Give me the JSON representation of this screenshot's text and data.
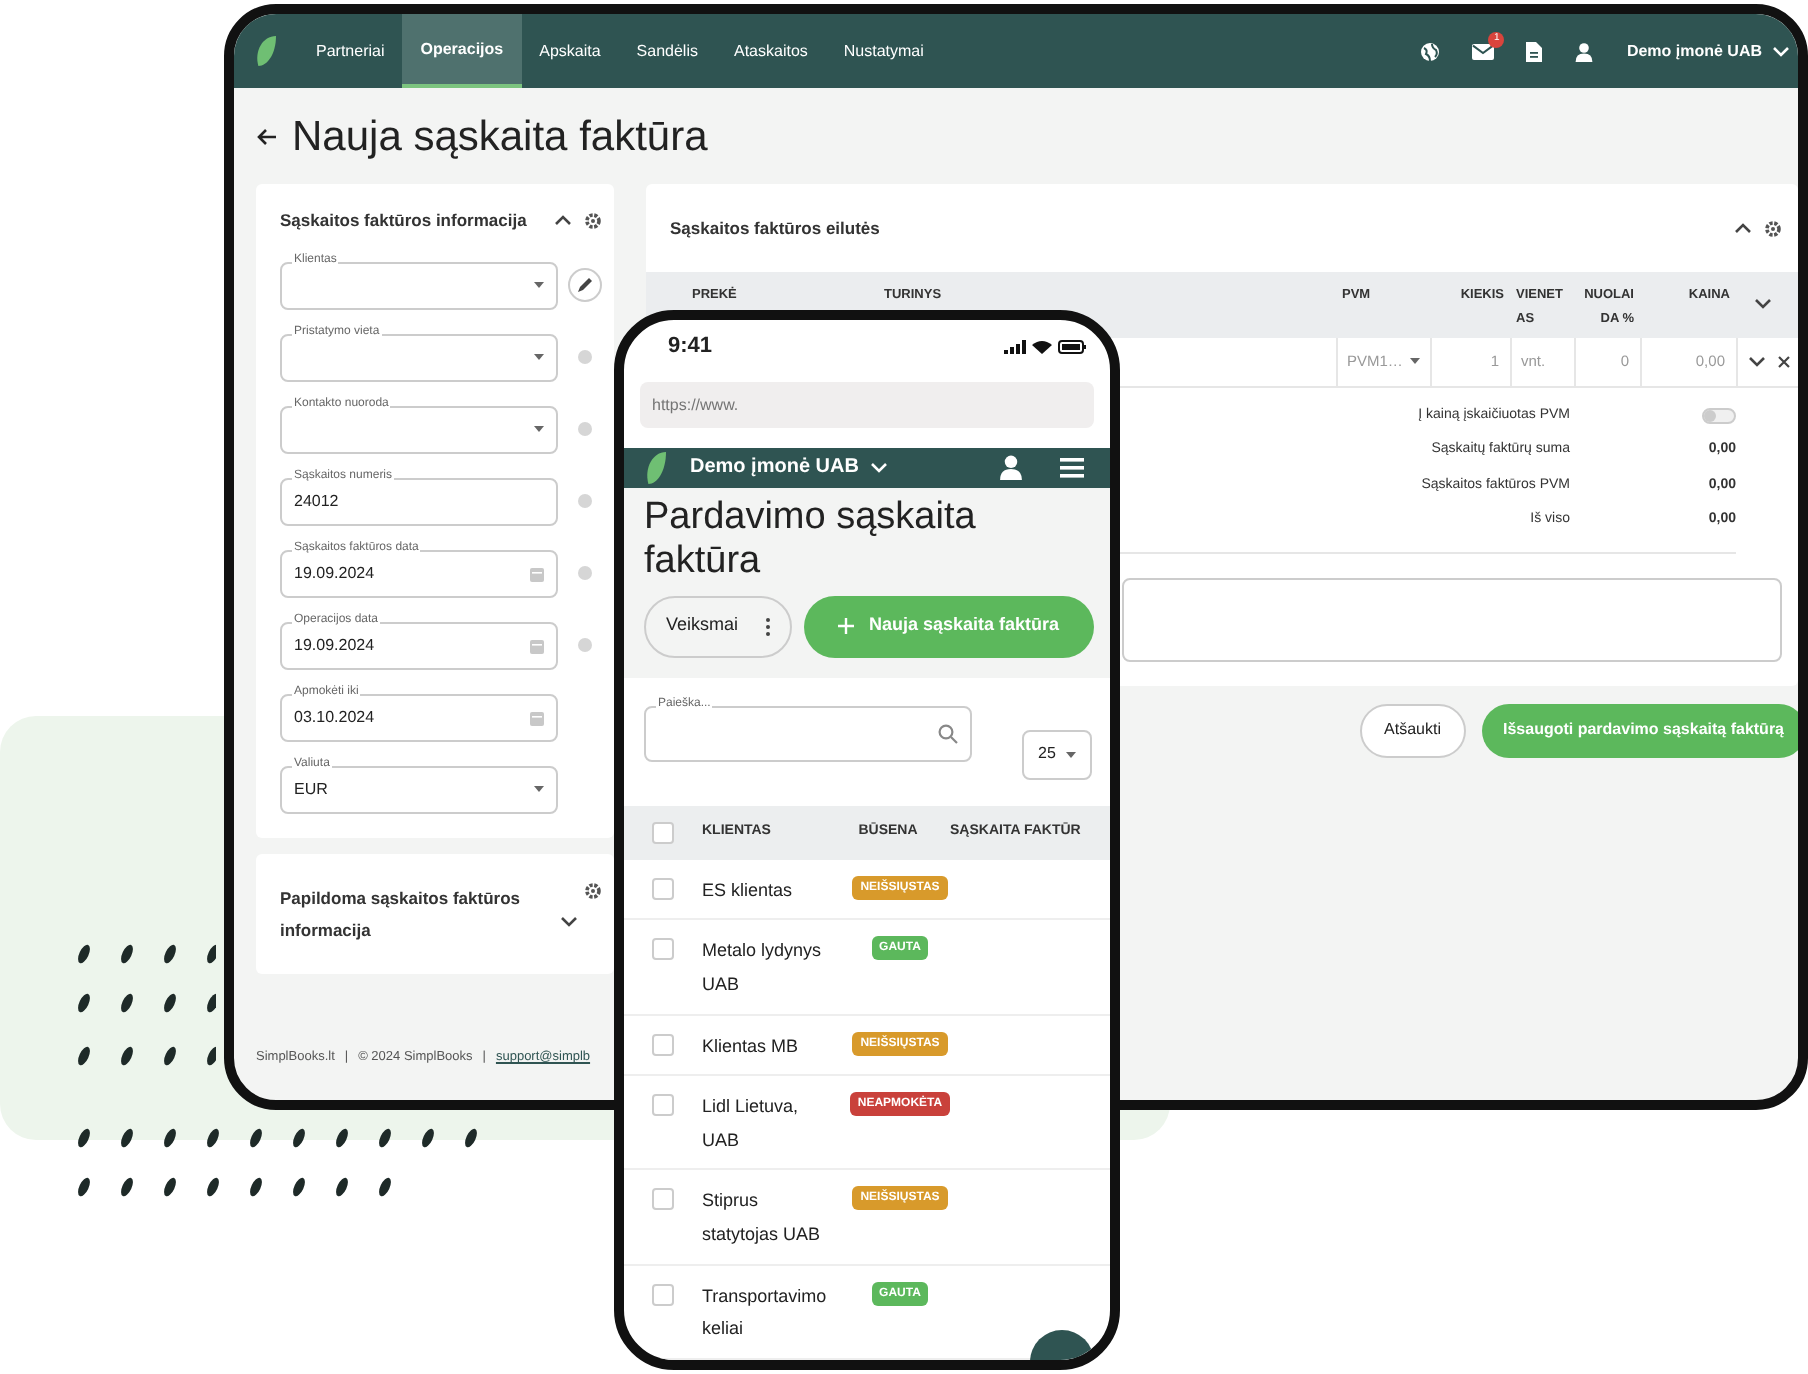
{
  "desktop": {
    "nav": {
      "items": [
        {
          "label": "Partneriai",
          "selected": false
        },
        {
          "label": "Operacijos",
          "selected": true
        },
        {
          "label": "Apskaita",
          "selected": false
        },
        {
          "label": "Sandėlis",
          "selected": false
        },
        {
          "label": "Ataskaitos",
          "selected": false
        },
        {
          "label": "Nustatymai",
          "selected": false
        }
      ],
      "mail_badge": "1",
      "company": "Demo įmonė UAB"
    },
    "page_title": "Nauja sąskaita faktūra",
    "info_card": {
      "title": "Sąskaitos faktūros informacija",
      "expanded": true,
      "fields": [
        {
          "label": "Klientas",
          "kind": "select",
          "edit_button": true,
          "info_icon": false
        },
        {
          "label": "Pristatymo vieta",
          "kind": "select",
          "edit_button": false,
          "info_icon": true
        },
        {
          "label": "Kontakto nuoroda",
          "kind": "select",
          "edit_button": false,
          "info_icon": true
        },
        {
          "label": "Sąskaitos numeris",
          "kind": "text",
          "value": "24012",
          "edit_button": false,
          "info_icon": true
        },
        {
          "label": "Sąskaitos faktūros data",
          "kind": "date",
          "value": "19.09.2024",
          "edit_button": false,
          "info_icon": true
        },
        {
          "label": "Operacijos data",
          "kind": "date",
          "value": "19.09.2024",
          "edit_button": false,
          "info_icon": true
        },
        {
          "label": "Apmokėti iki",
          "kind": "date",
          "value": "03.10.2024",
          "edit_button": false,
          "info_icon": false
        },
        {
          "label": "Valiuta",
          "kind": "select",
          "value": "EUR",
          "edit_button": false,
          "info_icon": false
        }
      ]
    },
    "extra_card": {
      "title": "Papildoma sąskaitos faktūros informacija",
      "expanded": false
    },
    "lines_card": {
      "title": "Sąskaitos faktūros eilutės",
      "expanded": true,
      "columns": [
        "PREKĖ",
        "TURINYS",
        "PVM",
        "KIEKIS",
        "VIENETAS",
        "NUOLAIDA %",
        "KAINA"
      ],
      "row": {
        "pvm": "PVM1…",
        "quantity": "1",
        "unit": "vnt.",
        "discount": "0",
        "price": "0,00"
      },
      "vat_toggle": {
        "label": "Į kainą įskaičiuotas PVM",
        "checked": false
      },
      "totals": [
        {
          "label": "Sąskaitų faktūrų suma",
          "value": "0,00"
        },
        {
          "label": "Sąskaitos faktūros PVM",
          "value": "0,00"
        },
        {
          "label": "Iš viso",
          "value": "0,00"
        }
      ]
    },
    "buttons": [
      "Atšaukti",
      "Išsaugoti pardavimo sąskaitą faktūrą"
    ],
    "footer": {
      "texts": [
        "SimplBooks.lt",
        "|",
        "© 2024 SimplBooks",
        "|"
      ],
      "link": "support@simplb"
    }
  },
  "phone": {
    "time": "9:41",
    "url_placeholder": "https://www.",
    "company": "Demo įmonė UAB",
    "title": "Pardavimo sąskaita faktūra",
    "actions_button": "Veiksmai",
    "new_button": "Nauja sąskaita faktūra",
    "search_label": "Paieška...",
    "page_size": "25",
    "columns": [
      "KLIENTAS",
      "BŪSENA",
      "SĄSKAITA FAKTŪR"
    ],
    "header_checked": false,
    "rows": [
      {
        "client": "ES klientas",
        "status": "NEIŠSIŲSTAS",
        "color": "#d89a2b",
        "checked": false
      },
      {
        "client": "Metalo lydynys UAB",
        "status": "GAUTA",
        "color": "#5cb85c",
        "checked": false
      },
      {
        "client": "Klientas MB",
        "status": "NEIŠSIŲSTAS",
        "color": "#d89a2b",
        "checked": false
      },
      {
        "client": "Lidl Lietuva, UAB",
        "status": "NEAPMOKĖTA",
        "color": "#c9413b",
        "checked": false
      },
      {
        "client": "Stiprus statytojas UAB",
        "status": "NEIŠSIŲSTAS",
        "color": "#d89a2b",
        "checked": false
      },
      {
        "client": "Transportavimo keliai",
        "status": "GAUTA",
        "color": "#5cb85c",
        "checked": false
      }
    ]
  }
}
